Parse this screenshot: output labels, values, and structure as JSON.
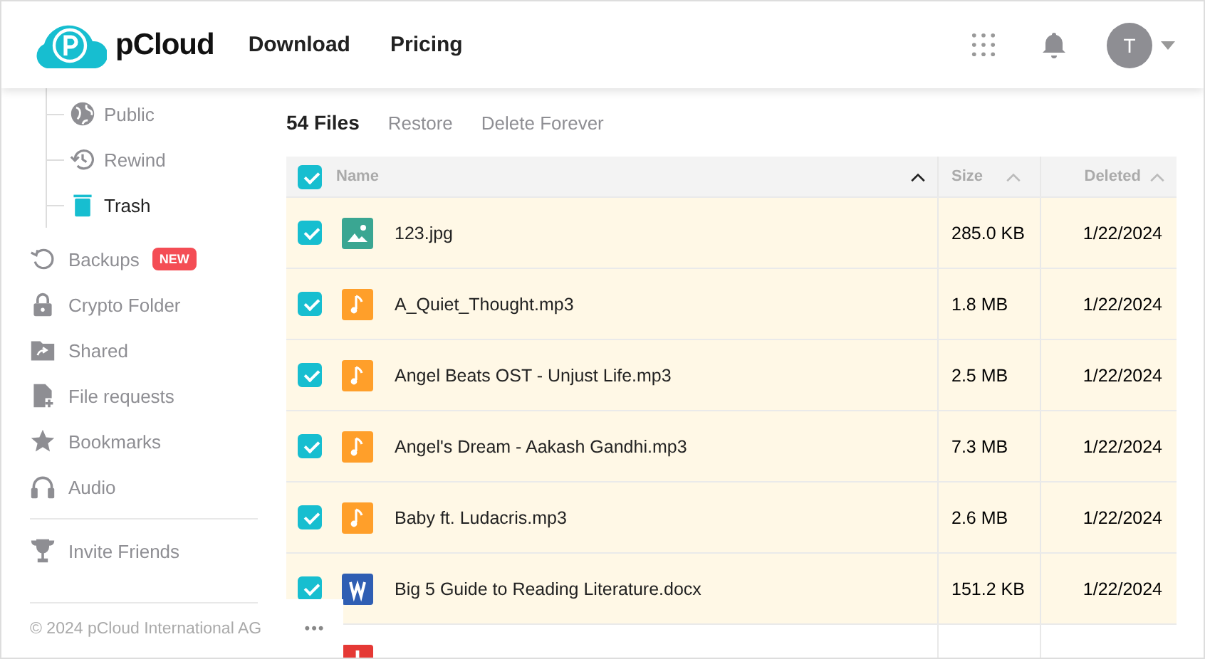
{
  "header": {
    "logo": "pCloud",
    "nav": [
      "Download",
      "Pricing"
    ],
    "avatar": "T"
  },
  "sidebar": {
    "tree": [
      {
        "label": "Public",
        "selected": false
      },
      {
        "label": "Rewind",
        "selected": false
      },
      {
        "label": "Trash",
        "selected": true
      }
    ],
    "items": [
      {
        "label": "Backups",
        "badge": "NEW"
      },
      {
        "label": "Crypto Folder"
      },
      {
        "label": "Shared"
      },
      {
        "label": "File requests"
      },
      {
        "label": "Bookmarks"
      },
      {
        "label": "Audio"
      }
    ],
    "extra": [
      {
        "label": "Invite Friends"
      }
    ],
    "footer": "© 2024 pCloud International AG",
    "more": "•••"
  },
  "toolbar": {
    "count": "54 Files",
    "actions": [
      "Restore",
      "Delete Forever"
    ]
  },
  "table": {
    "all_checked": true,
    "columns": [
      "Name",
      "Size",
      "Deleted"
    ],
    "rows": [
      {
        "kind": "image",
        "name": "123.jpg",
        "size": "285.0 KB",
        "deleted": "1/22/2024",
        "checked": true
      },
      {
        "kind": "audio",
        "name": "A_Quiet_Thought.mp3",
        "size": "1.8 MB",
        "deleted": "1/22/2024",
        "checked": true
      },
      {
        "kind": "audio",
        "name": "Angel Beats OST - Unjust Life.mp3",
        "size": "2.5 MB",
        "deleted": "1/22/2024",
        "checked": true
      },
      {
        "kind": "audio",
        "name": "Angel's Dream - Aakash Gandhi.mp3",
        "size": "7.3 MB",
        "deleted": "1/22/2024",
        "checked": true
      },
      {
        "kind": "audio",
        "name": "Baby ft. Ludacris.mp3",
        "size": "2.6 MB",
        "deleted": "1/22/2024",
        "checked": true
      },
      {
        "kind": "word",
        "name": "Big 5 Guide to Reading Literature.docx",
        "size": "151.2 KB",
        "deleted": "1/22/2024",
        "checked": true
      },
      {
        "kind": "pdf"
      }
    ]
  }
}
